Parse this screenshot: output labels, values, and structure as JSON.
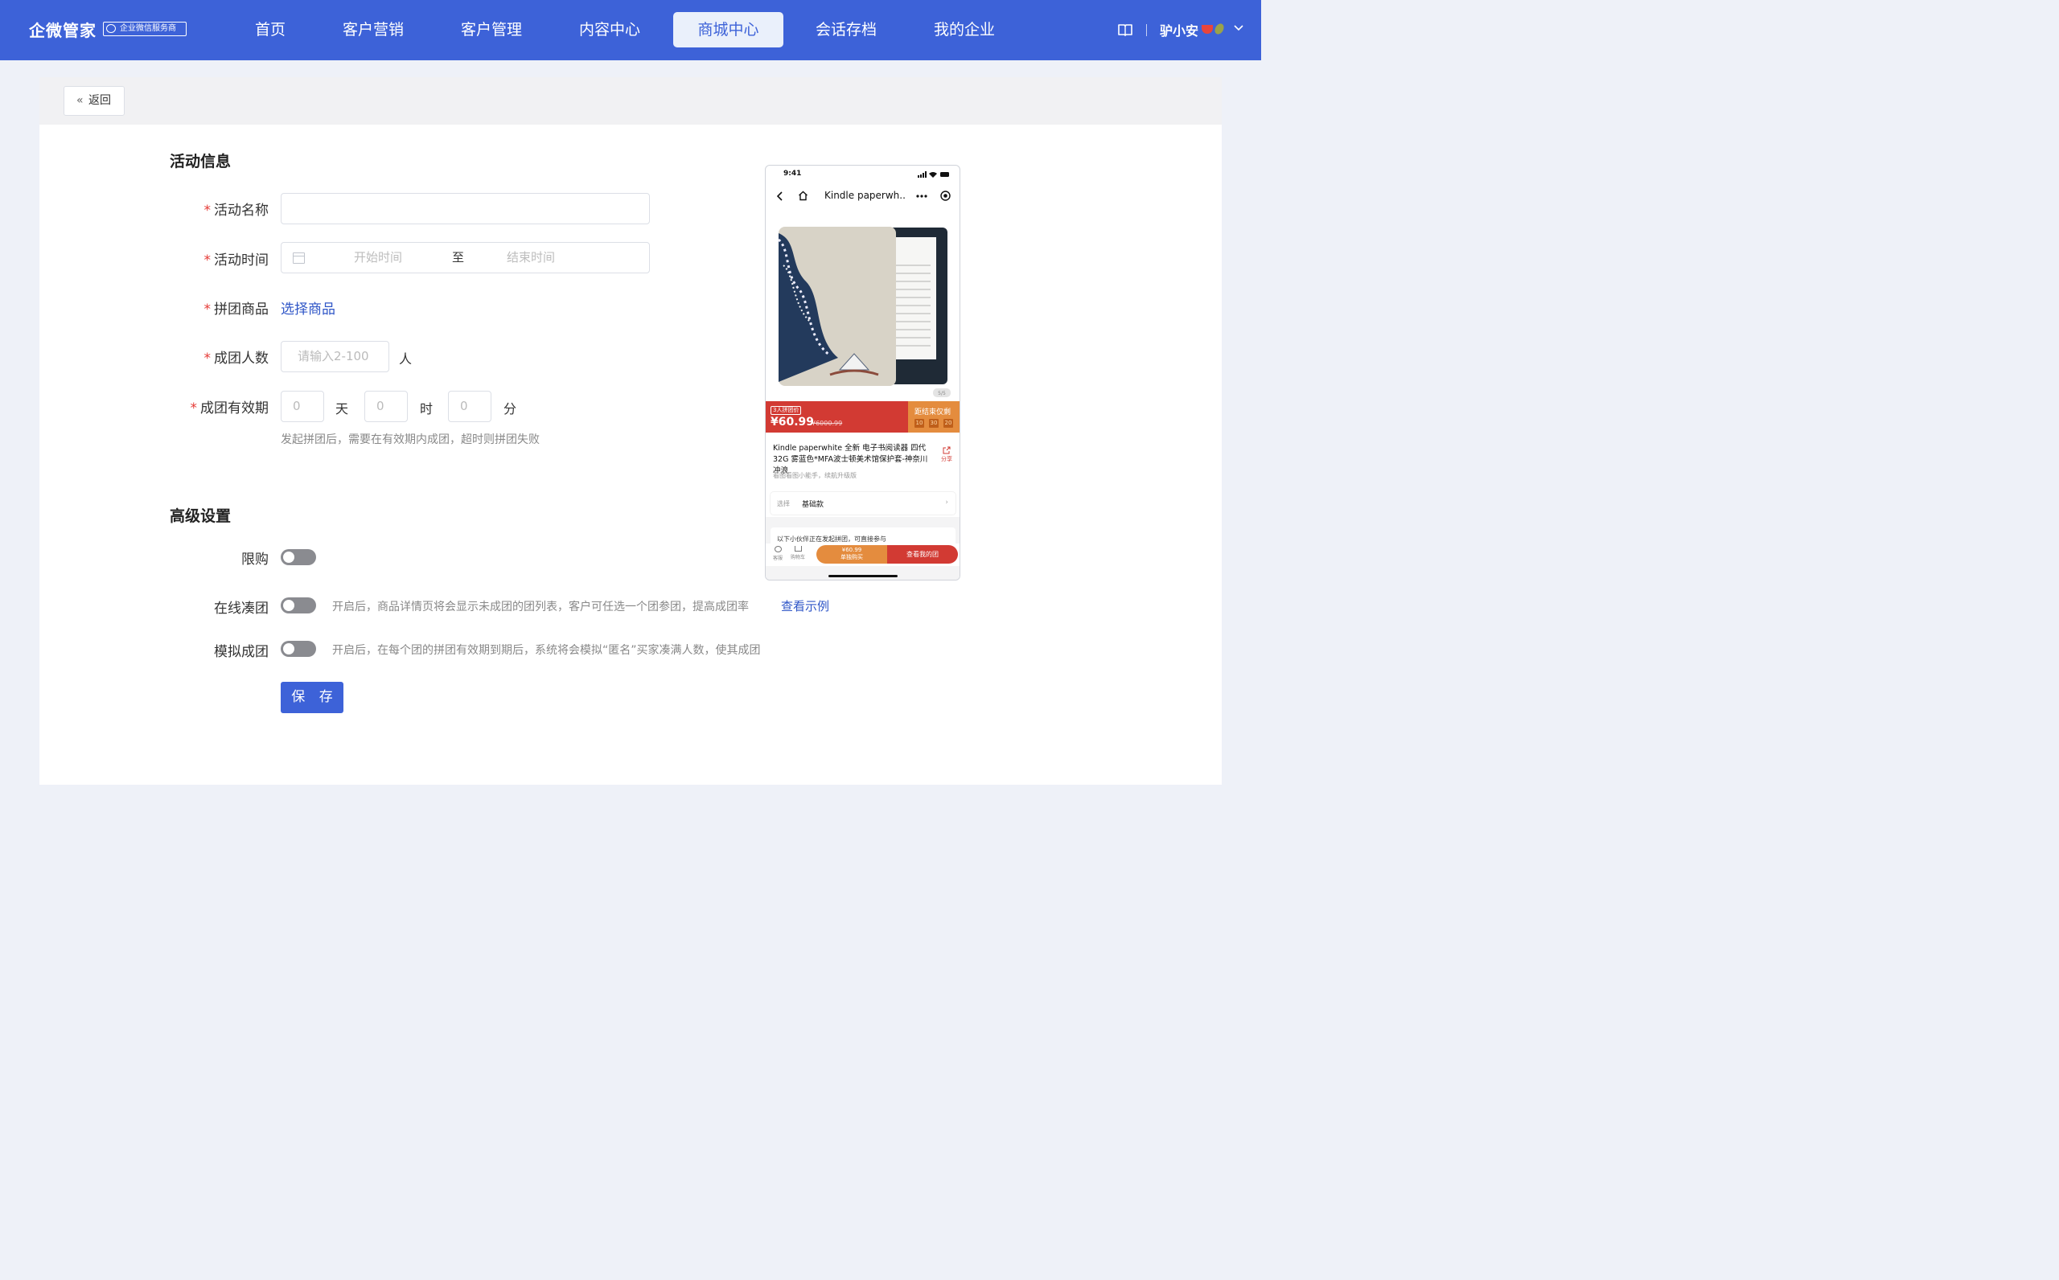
{
  "brand": {
    "name": "企微管家",
    "badge": "企业微信服务商"
  },
  "nav": {
    "items": [
      {
        "label": "首页"
      },
      {
        "label": "客户营销"
      },
      {
        "label": "客户管理"
      },
      {
        "label": "内容中心"
      },
      {
        "label": "商城中心",
        "active": true
      },
      {
        "label": "会话存档"
      },
      {
        "label": "我的企业"
      }
    ],
    "user": "驴小安",
    "accent_color": "#3d62d8"
  },
  "header": {
    "back_label": "返回"
  },
  "activity": {
    "section_title": "活动信息",
    "required_mark": "*",
    "name_label": "活动名称",
    "name_value": "",
    "time_label": "活动时间",
    "start_placeholder": "开始时间",
    "range_sep": "至",
    "end_placeholder": "结束时间",
    "product_label": "拼团商品",
    "product_link": "选择商品",
    "size_label": "成团人数",
    "size_placeholder": "请输入2-100",
    "size_unit": "人",
    "validity_label": "成团有效期",
    "days_placeholder": "0",
    "days_unit": "天",
    "hours_placeholder": "0",
    "hours_unit": "时",
    "minutes_placeholder": "0",
    "minutes_unit": "分",
    "validity_hint": "发起拼团后，需要在有效期内成团，超时则拼团失败"
  },
  "advanced": {
    "section_title": "高级设置",
    "limit_label": "限购",
    "limit_on": false,
    "online_label": "在线凑团",
    "online_on": false,
    "online_hint": "开启后，商品详情页将会显示未成团的团列表，客户可任选一个团参团，提高成团率",
    "online_link": "查看示例",
    "simulate_label": "模拟成团",
    "simulate_on": false,
    "simulate_hint": "开启后，在每个团的拼团有效期到期后，系统将会模拟“匿名”买家凑满人数，使其成团"
  },
  "save_label": "保 存",
  "preview": {
    "time": "9:41",
    "title": "Kindle paperwh..",
    "image_counter": "5/5",
    "group_tag": "3人拼团价",
    "price": "¥60.99",
    "old_price": "¥6000.99",
    "countdown_label": "距结束仅剩",
    "countdown": [
      "10",
      "30",
      "20"
    ],
    "product_name": "Kindle paperwhite 全新 电子书阅读器 四代32G 雾蓝色*MFA波士顿美术馆保护套-神奈川冲浪",
    "share": "分享",
    "subtitle": "看图看图小能手，续航升级版",
    "select_key": "选择",
    "select_value": "基础款",
    "invite_text": "以下小伙伴正在发起拼团，可直接参与",
    "service": "客服",
    "cart": "购物车",
    "buy_price": "¥60.99",
    "buy_label": "单独购买",
    "group_button": "查看我的团",
    "colors": {
      "red": "#d23a33",
      "orange": "#e48c3e"
    }
  }
}
